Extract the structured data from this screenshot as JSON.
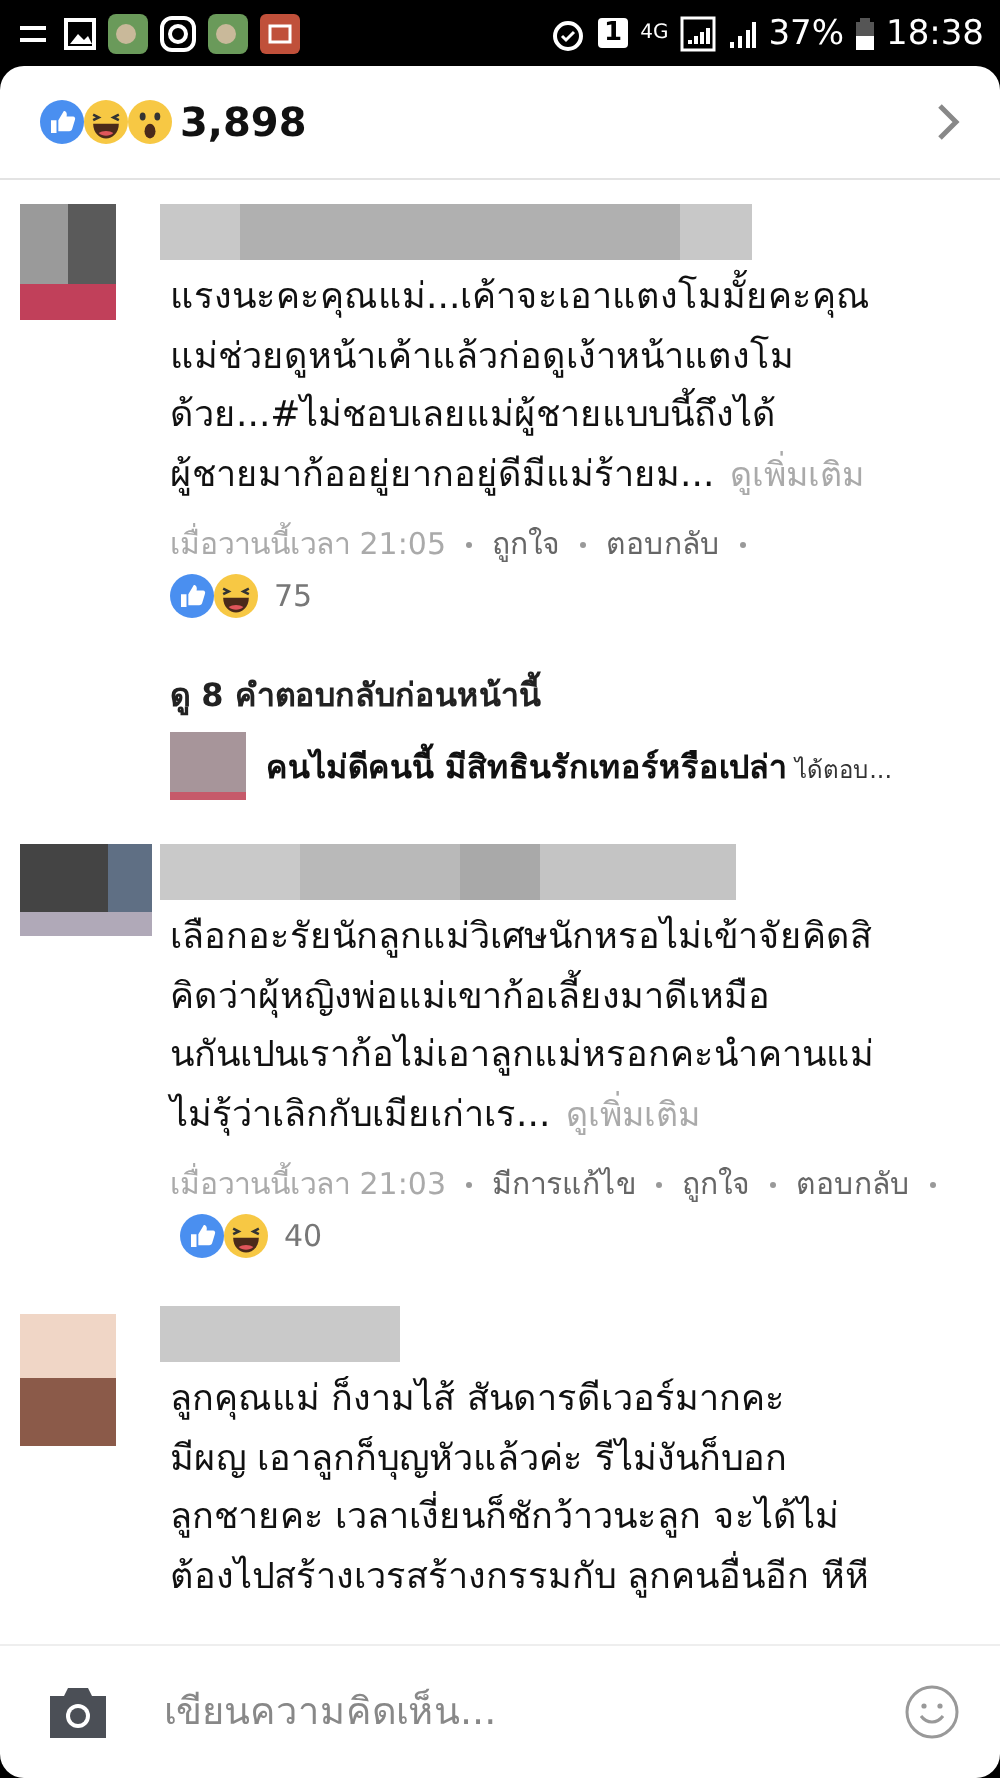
{
  "status_bar": {
    "sim": "1",
    "network": "4G",
    "battery": "37%",
    "time": "18:38"
  },
  "reactions": {
    "count": "3,898"
  },
  "comments": [
    {
      "text_lines": [
        "แรงนะคะคุณแม่...เค้าจะเอาแตงโมมั้ยคะคุณ",
        "แม่ช่วยดูหน้าเค้าแล้วก่อดูเง้าหน้าแตงโม",
        "ด้วย...#ไม่ชอบเลยแม่ผู้ชายแบบนี้ถึงได้",
        "ผู้ชายมาก้ออยู่ยากอยู่ดีมีแม่ร้ายม..."
      ],
      "see_more": "ดูเพิ่มเติม",
      "time": "เมื่อวานนี้เวลา 21:05",
      "actions": [
        "ถูกใจ",
        "ตอบกลับ"
      ],
      "reaction_count": "75",
      "replies": {
        "more_label": "ดู 8 คำตอบกลับก่อนหน้านี้",
        "preview_author": "คนไม่ดีคนนี้ มีสิทธินรักเทอร์หรือเปล่า",
        "preview_action": "ได้ตอบ..."
      }
    },
    {
      "text_lines": [
        "เลือกอะรัยนักลูกแม่วิเศษนักหรอไม่เข้าจัยคิดสิ",
        "คิดว่าผุ้หญิงพ่อแม่เขาก้อเลี้ยงมาดีเหมือ",
        "นกันเปนเราก้อไม่เอาลูกแม่หรอกคะนำคานแม่",
        "ไม่รุ้ว่าเลิกกับเมียเก่าเร..."
      ],
      "see_more": "ดูเพิ่มเติม",
      "time": "เมื่อวานนี้เวลา 21:03",
      "actions": [
        "มีการแก้ไข",
        "ถูกใจ",
        "ตอบกลับ"
      ],
      "reaction_count": "40"
    },
    {
      "text_lines": [
        "ลูกคุณแม่ ก็งามไส้ สันดารดีเวอร์มากคะ",
        "มีผญ เอาลูกก็บุญหัวแล้วค่ะ รีไม่งันก็บอก",
        "ลูกชายคะ เวลาเงี่ยนก็ชักว้าวนะลูก จะได้ไม่",
        "ต้องไปสร้างเวรสร้างกรรมกับ ลูกคนอื่นอีก หีหี"
      ]
    }
  ],
  "composer": {
    "placeholder": "เขียนความคิดเห็น..."
  }
}
